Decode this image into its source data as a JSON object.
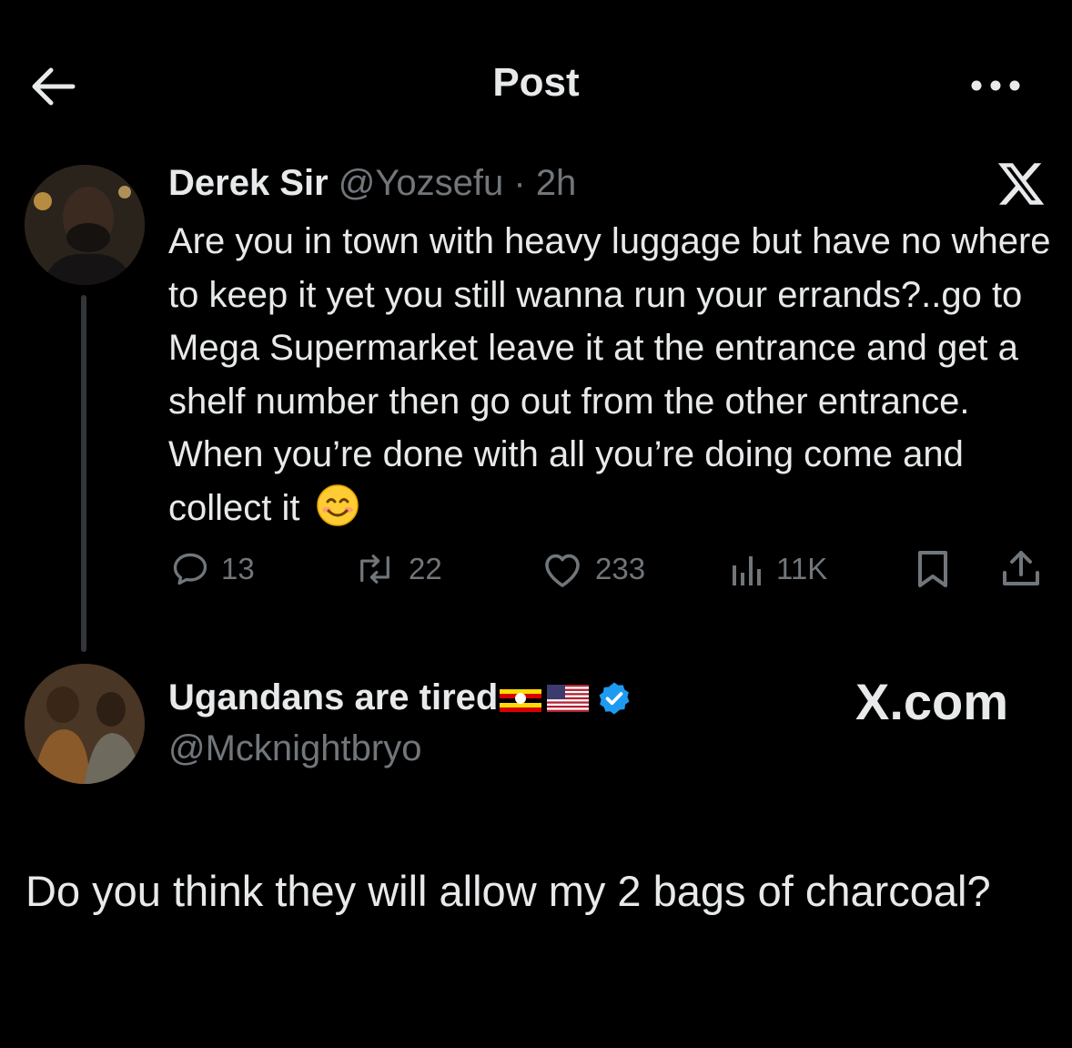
{
  "header": {
    "title": "Post"
  },
  "tweet1": {
    "author_name": "Derek Sir",
    "handle": "@Yozsefu",
    "separator": " · ",
    "time": "2h",
    "text": "Are you in town with heavy luggage but have no where to keep it yet you still wanna run your errands?..go to Mega Supermarket leave it at the entrance and get a shelf number then go out from the other entrance. When you’re done with all you’re doing come and collect it",
    "emoji": "smiling-face-emoji",
    "stats": {
      "replies": "13",
      "reposts": "22",
      "likes": "233",
      "views": "11K"
    }
  },
  "tweet2": {
    "author_name": "Ugandans are tired",
    "flags": [
      "uganda-flag",
      "usa-flag"
    ],
    "verified": true,
    "handle": "@Mcknightbryo",
    "text": "Do you think they will allow my 2 bags of charcoal?"
  },
  "watermark": {
    "text": "X.com"
  },
  "colors": {
    "background": "#000000",
    "text": "#e7e9ea",
    "muted": "#71767b",
    "verified": "#1d9bf0",
    "thread_line": "#333639"
  },
  "icons": [
    "back-arrow-icon",
    "more-icon",
    "x-logo-icon",
    "reply-icon",
    "repost-icon",
    "like-icon",
    "views-icon",
    "bookmark-icon",
    "share-icon",
    "verified-badge-icon"
  ]
}
